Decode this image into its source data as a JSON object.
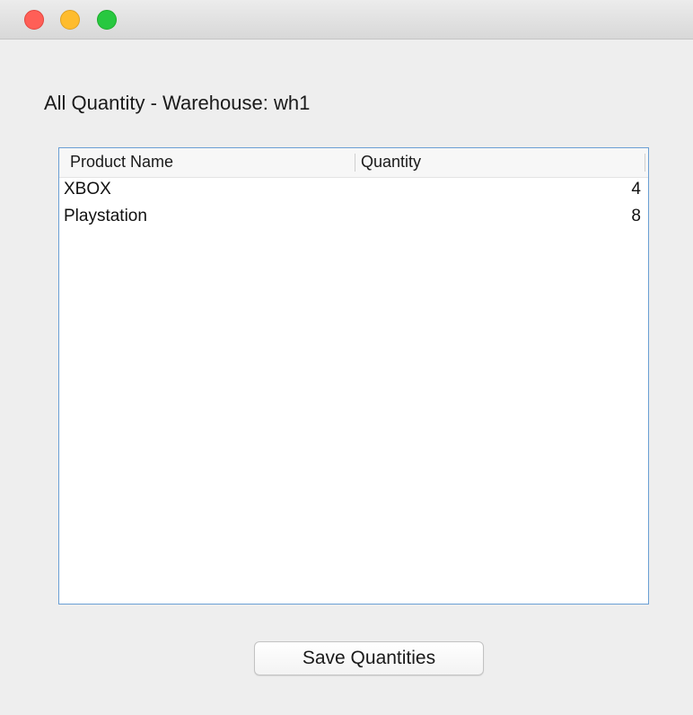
{
  "window": {
    "traffic_lights": {
      "close_color": "#ff5f57",
      "minimize_color": "#febc2e",
      "zoom_color": "#28c840"
    }
  },
  "heading": "All Quantity - Warehouse: wh1",
  "table": {
    "columns": [
      "Product Name",
      "Quantity"
    ],
    "rows": [
      {
        "product_name": "XBOX",
        "quantity": "4"
      },
      {
        "product_name": "Playstation",
        "quantity": "8"
      }
    ],
    "border_color": "#6a9fd4"
  },
  "save_button": {
    "label": "Save Quantities"
  }
}
